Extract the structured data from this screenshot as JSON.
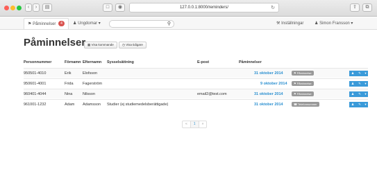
{
  "browser": {
    "url": "127.0.0.1:8000/reminders/"
  },
  "navbar": {
    "reminders_tab": "Påminnelser",
    "reminders_badge": "4",
    "students_tab": "Ungdomar",
    "settings": "Inställningar",
    "user": "Simon Fransson"
  },
  "page": {
    "title": "Påminnelser",
    "btn_show_upcoming": "Visa kommande",
    "btn_show_past": "Visa tidigare"
  },
  "table": {
    "headers": [
      "Personnummer",
      "Förnamn",
      "Efternamn",
      "Sysselsättning",
      "E-post",
      "Påminnelser"
    ],
    "rows": [
      {
        "pnr": "950501-4010",
        "first": "Erik",
        "last": "Elofsson",
        "occupation": "",
        "email": "",
        "date": "31 oktober 2014",
        "label": "Påminnelse"
      },
      {
        "pnr": "950601-4001",
        "first": "Frida",
        "last": "Fagerström",
        "occupation": "",
        "email": "",
        "date": "9 oktober 2014",
        "label": "Påminnelse"
      },
      {
        "pnr": "960401-4044",
        "first": "Nina",
        "last": "Nilsson",
        "occupation": "",
        "email": "email2@test.com",
        "date": "31 oktober 2014",
        "label": "Påminnelse"
      },
      {
        "pnr": "961001-1232",
        "first": "Adam",
        "last": "Adamsson",
        "occupation": "Studier (ej studiemedelsberättigade)",
        "email": "",
        "date": "31 oktober 2014",
        "label": "Telefonnummer"
      }
    ]
  },
  "pagination": {
    "prev": "«",
    "current": "1",
    "next": "»"
  },
  "colors": {
    "accent": "#2a8fd0",
    "badge": "#d9534f",
    "action": "#3a9ad9"
  }
}
